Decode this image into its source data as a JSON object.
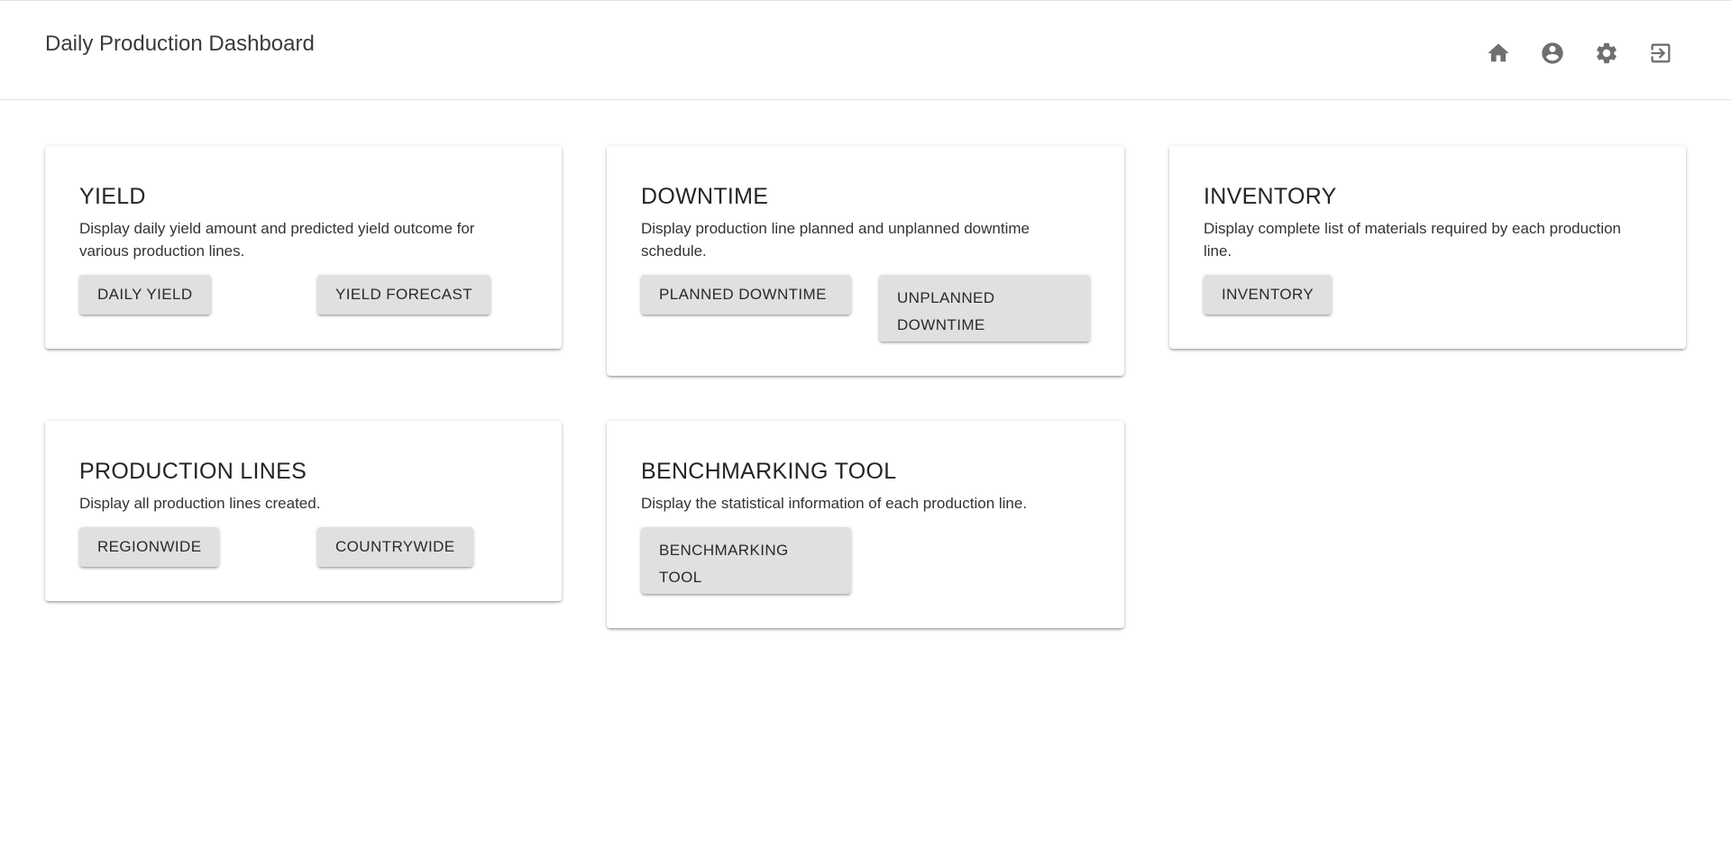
{
  "header": {
    "title": "Daily Production Dashboard",
    "icons": [
      "home-icon",
      "account-circle-icon",
      "settings-icon",
      "logout-icon"
    ]
  },
  "cards": {
    "yield": {
      "title": "YIELD",
      "description": "Display daily yield amount and predicted yield outcome for various production lines.",
      "buttons": [
        "DAILY YIELD",
        "YIELD FORECAST"
      ]
    },
    "downtime": {
      "title": "DOWNTIME",
      "description": "Display production line planned and unplanned downtime schedule.",
      "buttons": [
        "PLANNED DOWNTIME",
        "UNPLANNED DOWNTIME"
      ]
    },
    "inventory": {
      "title": "INVENTORY",
      "description": "Display complete list of materials required by each production line.",
      "buttons": [
        "INVENTORY"
      ]
    },
    "production_lines": {
      "title": "PRODUCTION LINES",
      "description": "Display all production lines created.",
      "buttons": [
        "REGIONWIDE",
        "COUNTRYWIDE"
      ]
    },
    "benchmarking": {
      "title": "BENCHMARKING TOOL",
      "description": "Display the statistical information of each production line.",
      "buttons": [
        "BENCHMARKING TOOL"
      ]
    }
  },
  "colors": {
    "icon": "#6f6f6f",
    "button_bg": "#e0e0e0",
    "divider": "#e2e2e2"
  }
}
